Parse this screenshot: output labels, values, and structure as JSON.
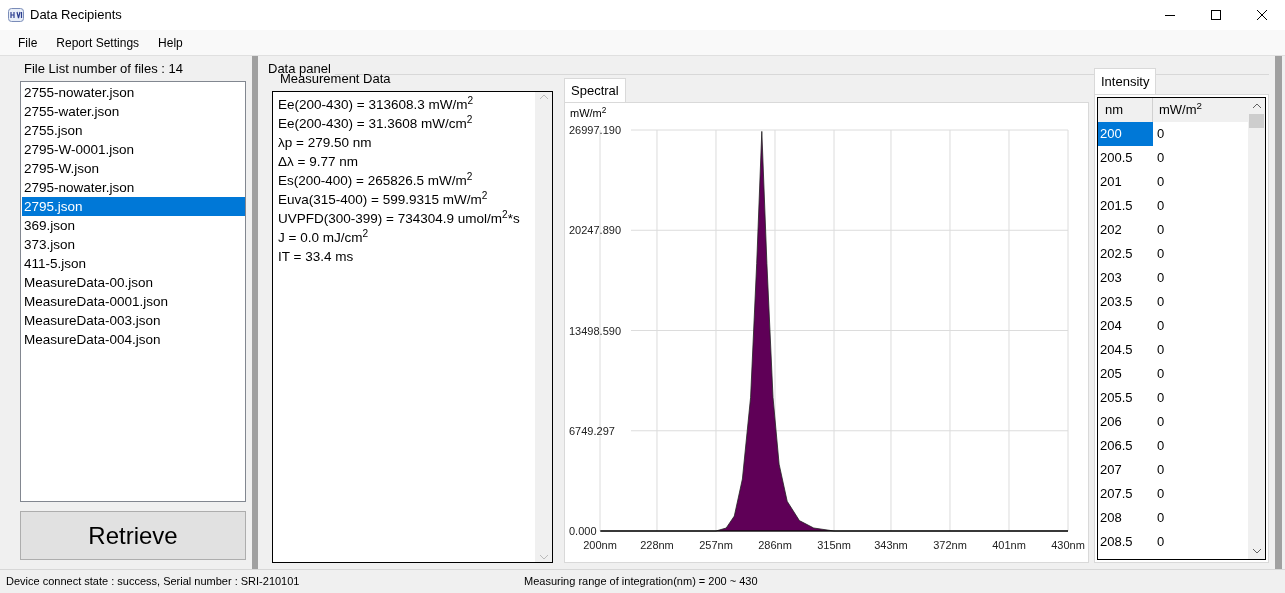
{
  "window": {
    "title": "Data Recipients"
  },
  "menu": [
    "File",
    "Report Settings",
    "Help"
  ],
  "file_list": {
    "title": "File List number of files : 14",
    "items": [
      {
        "label": "2755-nowater.json",
        "selected": false
      },
      {
        "label": "2755-water.json",
        "selected": false
      },
      {
        "label": "2755.json",
        "selected": false
      },
      {
        "label": "2795-W-0001.json",
        "selected": false
      },
      {
        "label": "2795-W.json",
        "selected": false
      },
      {
        "label": "2795-nowater.json",
        "selected": false
      },
      {
        "label": "2795.json",
        "selected": true
      },
      {
        "label": "369.json",
        "selected": false
      },
      {
        "label": "373.json",
        "selected": false
      },
      {
        "label": "411-5.json",
        "selected": false
      },
      {
        "label": "MeasureData-00.json",
        "selected": false
      },
      {
        "label": "MeasureData-0001.json",
        "selected": false
      },
      {
        "label": "MeasureData-003.json",
        "selected": false
      },
      {
        "label": "MeasureData-004.json",
        "selected": false
      }
    ]
  },
  "retrieve_button": "Retrieve",
  "data_panel": {
    "title": "Data panel",
    "measurement": {
      "title": "Measurement Data",
      "lines": [
        "Ee(200-430) = 313608.3 mW/m$^{2}$",
        "Ee(200-430) = 31.3608 mW/cm$^{2}$",
        "λp = 279.50 nm",
        "Δλ = 9.77 nm",
        "Es(200-400) = 265826.5 mW/m$^{2}$",
        "Euva(315-400) = 599.9315 mW/m$^{2}$",
        "UVPFD(300-399) = 734304.9 umol/m$^{2}$*s",
        "J = 0.0 mJ/cm$^{2}$",
        "IT = 33.4 ms"
      ]
    },
    "spectral": {
      "tabs": [
        {
          "label": "Spectral",
          "selected": true
        }
      ],
      "unit": "mW/m$^{2}$",
      "chart_data": {
        "type": "area",
        "x": [
          200,
          257,
          262,
          266,
          270,
          274,
          277,
          279.5,
          282,
          285,
          288,
          292,
          298,
          305,
          315,
          430
        ],
        "series": [
          {
            "color": "#5f0057",
            "values": [
              0,
              0,
              200,
              1000,
              3500,
              9000,
              18000,
              26900,
              18000,
              9000,
              4500,
              2000,
              700,
              200,
              0,
              0
            ]
          }
        ],
        "grid": true,
        "xlim": [
          200,
          430
        ],
        "ylim": [
          0,
          26997.19
        ],
        "xticks": [
          {
            "value": 200,
            "label": "200nm"
          },
          {
            "value": 228,
            "label": "228nm"
          },
          {
            "value": 257,
            "label": "257nm"
          },
          {
            "value": 286,
            "label": "286nm"
          },
          {
            "value": 315,
            "label": "315nm"
          },
          {
            "value": 343,
            "label": "343nm"
          },
          {
            "value": 372,
            "label": "372nm"
          },
          {
            "value": 401,
            "label": "401nm"
          },
          {
            "value": 430,
            "label": "430nm"
          }
        ],
        "yticks": [
          {
            "value": 0,
            "label": "0.000"
          },
          {
            "value": 6749.297,
            "label": "6749.297"
          },
          {
            "value": 13498.59,
            "label": "13498.590"
          },
          {
            "value": 20247.89,
            "label": "20247.890"
          },
          {
            "value": 26997.19,
            "label": "26997.190"
          }
        ]
      }
    },
    "intensity": {
      "tabs": [
        {
          "label": "Intensity",
          "selected": true
        }
      ],
      "columns": [
        "nm",
        "mW/m$^{2}$"
      ],
      "rows": [
        {
          "nm": "200",
          "value": "0",
          "selected": true
        },
        {
          "nm": "200.5",
          "value": "0",
          "selected": false
        },
        {
          "nm": "201",
          "value": "0",
          "selected": false
        },
        {
          "nm": "201.5",
          "value": "0",
          "selected": false
        },
        {
          "nm": "202",
          "value": "0",
          "selected": false
        },
        {
          "nm": "202.5",
          "value": "0",
          "selected": false
        },
        {
          "nm": "203",
          "value": "0",
          "selected": false
        },
        {
          "nm": "203.5",
          "value": "0",
          "selected": false
        },
        {
          "nm": "204",
          "value": "0",
          "selected": false
        },
        {
          "nm": "204.5",
          "value": "0",
          "selected": false
        },
        {
          "nm": "205",
          "value": "0",
          "selected": false
        },
        {
          "nm": "205.5",
          "value": "0",
          "selected": false
        },
        {
          "nm": "206",
          "value": "0",
          "selected": false
        },
        {
          "nm": "206.5",
          "value": "0",
          "selected": false
        },
        {
          "nm": "207",
          "value": "0",
          "selected": false
        },
        {
          "nm": "207.5",
          "value": "0",
          "selected": false
        },
        {
          "nm": "208",
          "value": "0",
          "selected": false
        },
        {
          "nm": "208.5",
          "value": "0",
          "selected": false
        }
      ]
    }
  },
  "status_bar": {
    "left": "Device connect state : success, Serial number : SRI-210101",
    "right": "Measuring range of integration(nm) = 200 ~ 430"
  }
}
